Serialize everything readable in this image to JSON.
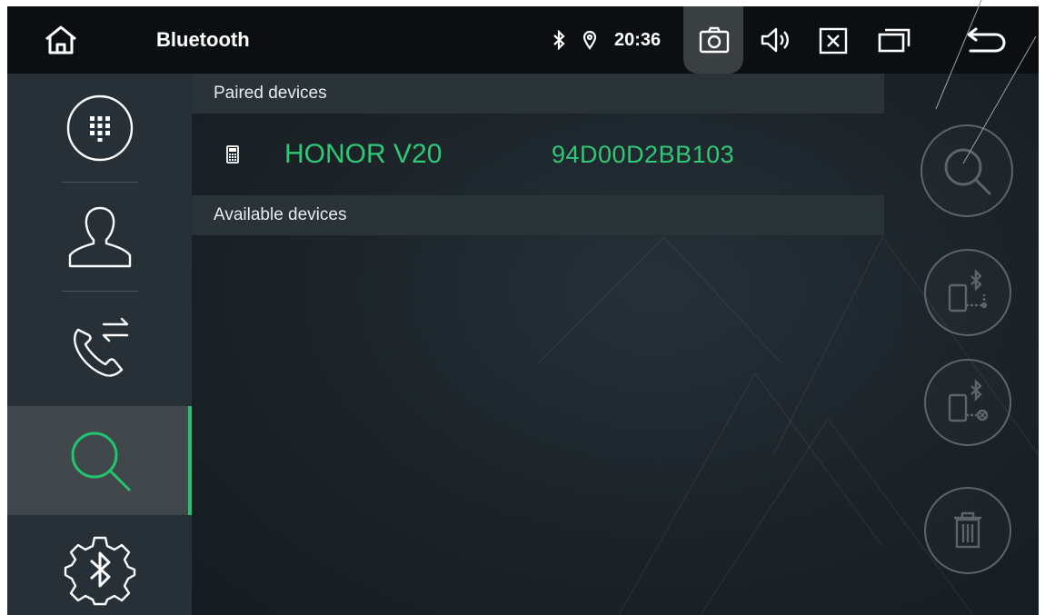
{
  "window": {
    "title": "Bluetooth"
  },
  "status": {
    "time": "20:36"
  },
  "sections": {
    "paired_label": "Paired devices",
    "available_label": "Available devices"
  },
  "paired_devices": [
    {
      "name": "HONOR V20",
      "address": "94D00D2BB103"
    }
  ],
  "topbar_icons": [
    "home-icon",
    "bluetooth-icon",
    "location-icon",
    "camera-icon",
    "volume-icon",
    "close-app-icon",
    "recent-apps-icon",
    "back-icon"
  ],
  "sidebar_icons": [
    "dialpad-icon",
    "contacts-icon",
    "call-log-icon",
    "search-devices-icon",
    "bluetooth-settings-icon"
  ],
  "action_icons": [
    "search-icon",
    "connect-device-icon",
    "disconnect-device-icon",
    "delete-icon"
  ],
  "colors": {
    "accent": "#2fc874",
    "topbar": "#0c0f11",
    "sidebar": "#273036",
    "active_tab": "#40484c"
  }
}
